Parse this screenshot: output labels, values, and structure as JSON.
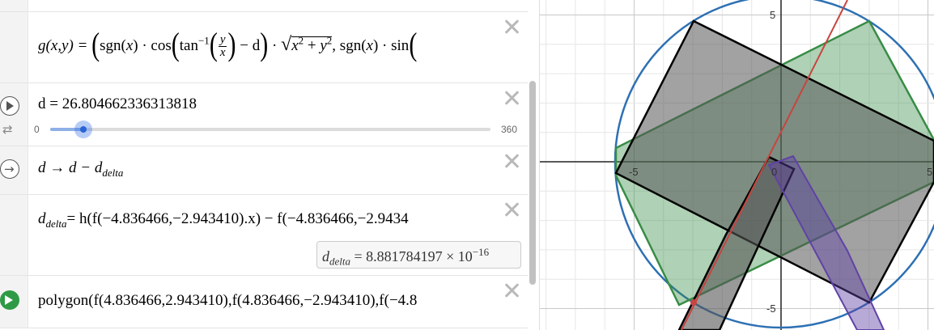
{
  "expressions": {
    "g": {
      "lhs": "g(x,y) =",
      "sgn": "sgn",
      "x": "x",
      "cos": "cos",
      "tan": "tan",
      "inv": "−1",
      "frac_num": "y",
      "frac_den": "x",
      "minus_d": "− d",
      "dot": "·",
      "sqrt_x": "x",
      "sqrt_y": "y",
      "exp": "2",
      "plus": "+",
      "comma": ",",
      "sin": "sin"
    },
    "d": {
      "text": "d = 26.804662336313818",
      "slider_min": "0",
      "slider_max": "360",
      "slider_fraction": 0.0745
    },
    "action": {
      "lhs": "d → d − d",
      "sub": "delta"
    },
    "d_delta": {
      "lhs": "d",
      "sub": "delta",
      "rhs": "= h(f(−4.836466,−2.943410).x) − f(−4.836466,−2.9434",
      "eval_lhs": "d",
      "eval_sub": "delta",
      "eval_value": "=  8.881784197 × 10",
      "eval_exp": "−16"
    },
    "polygon": {
      "text": "polygon(f(4.836466,2.943410),f(4.836466,−2.943410),f(−4.8"
    }
  },
  "graph": {
    "x_labels": [
      "-5",
      "0",
      "5"
    ],
    "y_labels": [
      "5",
      "-5"
    ],
    "colors": {
      "circle": "#2d70b3",
      "line": "#c74440",
      "green": "#388c46",
      "black": "#000000",
      "purple": "#6042a6"
    }
  }
}
